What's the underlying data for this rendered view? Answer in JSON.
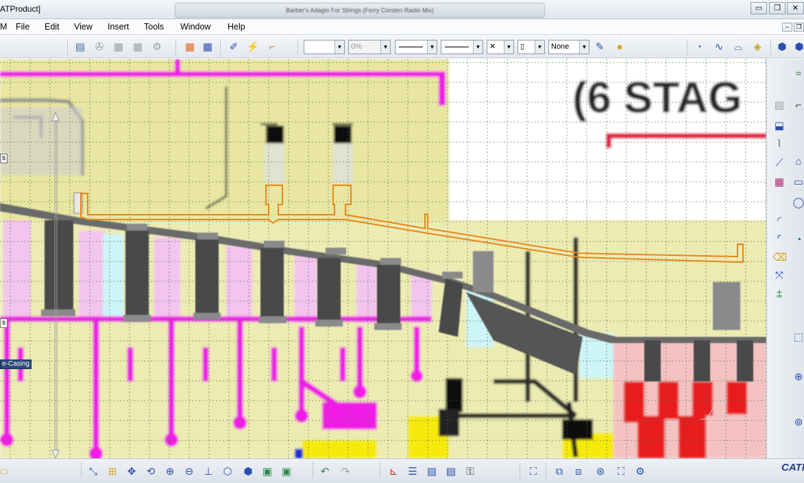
{
  "window": {
    "title": "ATProduct]",
    "tab_title": "Barber's Adagio For Strings (Ferry Corsten Radio Mix)",
    "controls": {
      "minimize": "▭",
      "restore": "❐",
      "close": "✕"
    }
  },
  "menu": {
    "items": [
      {
        "label": "M",
        "name": "menu-start"
      },
      {
        "label": "File",
        "name": "menu-file"
      },
      {
        "label": "Edit",
        "name": "menu-edit"
      },
      {
        "label": "View",
        "name": "menu-view"
      },
      {
        "label": "Insert",
        "name": "menu-insert"
      },
      {
        "label": "Tools",
        "name": "menu-tools"
      },
      {
        "label": "Window",
        "name": "menu-window"
      },
      {
        "label": "Help",
        "name": "menu-help"
      }
    ],
    "mdi_controls": {
      "minimize": "–",
      "restore": "❐"
    }
  },
  "graphic_properties": {
    "color": "",
    "transparency": "0%",
    "line_type": "",
    "line_thickness": "",
    "point_symbol": "✕",
    "layer_index": "▯",
    "layer": "None"
  },
  "tree": {
    "labels": [
      {
        "text": "s"
      },
      {
        "text": "s"
      },
      {
        "text": "e-Casing"
      }
    ]
  },
  "drawing": {
    "background_text": "(6 STAG",
    "grid_color": "#5c6f5c",
    "sketch_color": "#e8841a",
    "part_color": "#5a5a5a"
  },
  "colors": {
    "canvas_bg": "#ffffff",
    "paper_yellow": "#e8e6a0",
    "magenta": "#f01ee6",
    "red": "#e81d1d",
    "yellow_part": "#f6ea10",
    "cyan_part": "#cdf4f6",
    "pink_part": "#f3c4ee"
  },
  "toolbar_icons": {
    "top_left": [
      "update-all-icon",
      "generate-icon",
      "manage-icon",
      "fast-multi-instantiation-icon",
      "catalog-icon"
    ],
    "grid": [
      "snap-to-grid-icon",
      "grid-icon"
    ],
    "sketch": [
      "sketch-icon",
      "constraint-icon",
      "measure-icon"
    ],
    "right_of_props": [
      "paint-brush-icon",
      "apply-material-icon"
    ],
    "far_right": [
      "point-icon",
      "curve-icon",
      "surface-icon",
      "tag-icon",
      "part-icon",
      "product-icon"
    ],
    "bottom": [
      "compass-icon",
      "fit-all-icon",
      "pan-icon",
      "rotate-icon",
      "zoom-in-icon",
      "zoom-out-icon",
      "normal-view-icon",
      "iso-view-icon",
      "shading-icon",
      "hide-show-icon",
      "swap-visible-icon",
      "undo-icon",
      "redo-icon",
      "axis-icon",
      "list-icon",
      "parameters-icon",
      "formula-icon",
      "knowledge-icon",
      "snapshot-icon",
      "assembly-icon",
      "new-component-icon",
      "measure-between-icon",
      "clash-icon",
      "constraints-icon"
    ]
  },
  "brand": "CATIA"
}
